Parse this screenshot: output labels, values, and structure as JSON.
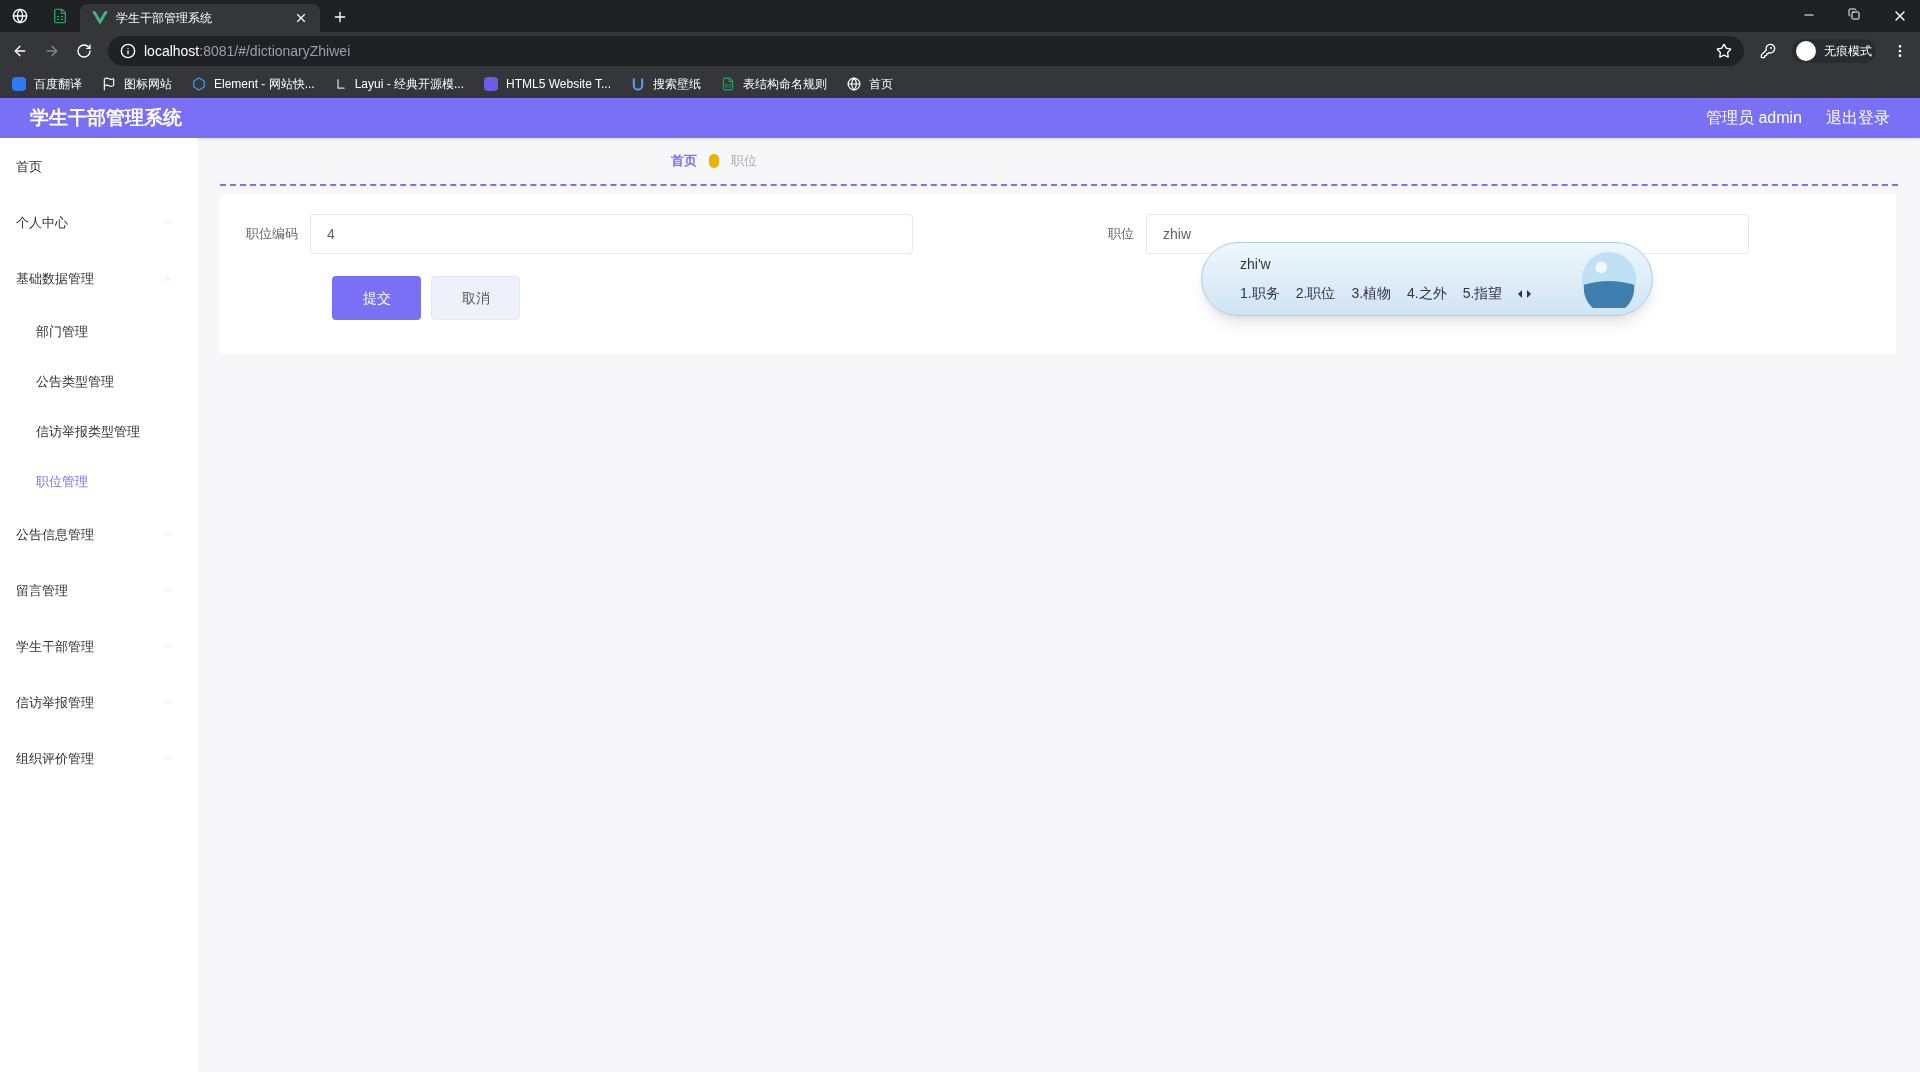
{
  "browser": {
    "tabs": [
      {
        "kind": "pinned",
        "selected": false
      },
      {
        "kind": "pinned",
        "selected": false
      },
      {
        "kind": "page",
        "title": "学生干部管理系统",
        "selected": true
      }
    ],
    "address": {
      "host": "localhost",
      "rest": ":8081/#/dictionaryZhiwei"
    },
    "profile": "无痕模式",
    "bookmarks": [
      "百度翻译",
      "图标网站",
      "Element - 网站快...",
      "Layui - 经典开源模...",
      "HTML5 Website T...",
      "搜索壁纸",
      "表结构命名规则",
      "首页"
    ]
  },
  "header": {
    "title": "学生干部管理系统",
    "user": "管理员 admin",
    "logout": "退出登录"
  },
  "sidebar": {
    "items": [
      {
        "label": "首页",
        "selected": false
      },
      {
        "label": "个人中心",
        "expanded": false,
        "selected": false
      },
      {
        "label": "基础数据管理",
        "expanded": true,
        "selected": false,
        "children": [
          {
            "label": "部门管理",
            "selected": false
          },
          {
            "label": "公告类型管理",
            "selected": false
          },
          {
            "label": "信访举报类型管理",
            "selected": false
          },
          {
            "label": "职位管理",
            "selected": true
          }
        ]
      },
      {
        "label": "公告信息管理",
        "expanded": false,
        "selected": false
      },
      {
        "label": "留言管理",
        "expanded": false,
        "selected": false
      },
      {
        "label": "学生干部管理",
        "expanded": false,
        "selected": false
      },
      {
        "label": "信访举报管理",
        "expanded": false,
        "selected": false
      },
      {
        "label": "组织评价管理",
        "expanded": false,
        "selected": false
      }
    ]
  },
  "breadcrumb": [
    {
      "label": "首页",
      "selected": false
    },
    {
      "label": "职位",
      "selected": true
    }
  ],
  "form": {
    "fields": [
      {
        "label": "职位编码",
        "value": "4"
      },
      {
        "label": "职位",
        "value": "zhiw"
      }
    ],
    "buttons": [
      {
        "label": "提交",
        "kind": "primary"
      },
      {
        "label": "取消",
        "kind": "secondary"
      }
    ]
  },
  "ime": {
    "composition": "zhi'w",
    "candidates": [
      "1.职务",
      "2.职位",
      "3.植物",
      "4.之外",
      "5.指望"
    ]
  }
}
